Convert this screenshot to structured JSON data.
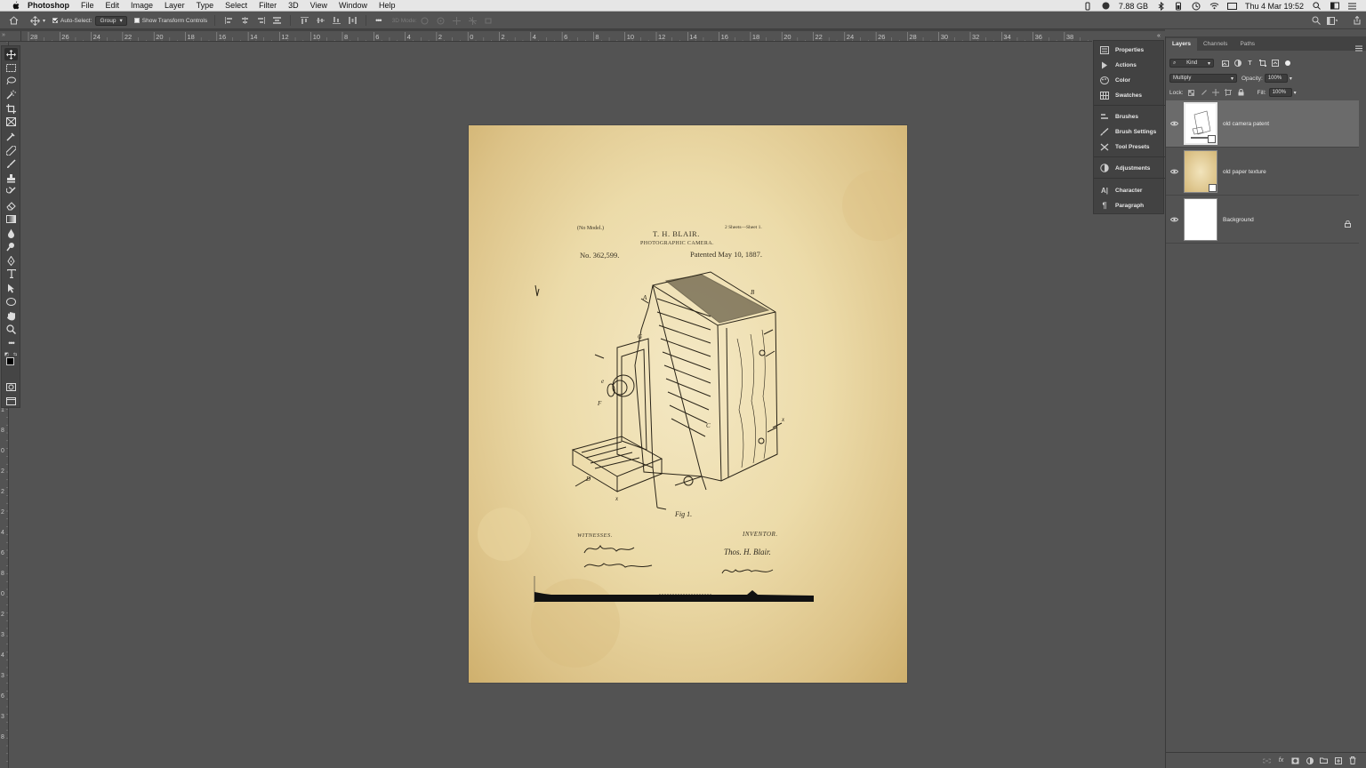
{
  "menubar": {
    "app_name": "Photoshop",
    "menus": [
      "File",
      "Edit",
      "Image",
      "Layer",
      "Type",
      "Select",
      "Filter",
      "3D",
      "View",
      "Window",
      "Help"
    ],
    "memory": "7.88 GB",
    "datetime": "Thu 4 Mar  19:52"
  },
  "options": {
    "auto_select_label": "Auto-Select:",
    "auto_select_checked": true,
    "auto_select_target": "Group",
    "transform_controls_label": "Show Transform Controls",
    "transform_controls_checked": false,
    "mode_3d_label": "3D Mode:"
  },
  "rulers": {
    "horizontal": [
      "28",
      "26",
      "24",
      "22",
      "20",
      "18",
      "16",
      "14",
      "12",
      "10",
      "8",
      "6",
      "4",
      "2",
      "0",
      "2",
      "4",
      "6",
      "8",
      "10",
      "12",
      "14",
      "16",
      "18",
      "20",
      "22",
      "24",
      "26",
      "28",
      "30",
      "32",
      "34",
      "36",
      "38"
    ],
    "vertical": [
      "1",
      "8",
      "0",
      "2",
      "2",
      "2",
      "4",
      "6",
      "8",
      "0",
      "2",
      "3",
      "4",
      "3",
      "6",
      "3",
      "8"
    ]
  },
  "tools": [
    "move-tool",
    "marquee-tool",
    "lasso-tool",
    "magic-wand-tool",
    "crop-tool",
    "frame-tool",
    "eyedropper-tool",
    "healing-brush-tool",
    "brush-tool",
    "clone-stamp-tool",
    "history-brush-tool",
    "eraser-tool",
    "gradient-tool",
    "blur-tool",
    "dodge-tool",
    "pen-tool",
    "type-tool",
    "path-selection-tool",
    "shape-tool",
    "hand-tool",
    "zoom-tool",
    "more-tools"
  ],
  "docked_panels": {
    "group1": [
      "Properties",
      "Actions",
      "Color",
      "Swatches"
    ],
    "group2": [
      "Brushes",
      "Brush Settings",
      "Tool Presets"
    ],
    "group3": [
      "Adjustments"
    ],
    "group4": [
      "Character",
      "Paragraph"
    ]
  },
  "layers_panel": {
    "tabs": [
      "Layers",
      "Channels",
      "Paths"
    ],
    "filter_kind": "Kind",
    "blend_mode": "Multiply",
    "opacity_label": "Opacity:",
    "opacity_value": "100%",
    "lock_label": "Lock:",
    "fill_label": "Fill:",
    "fill_value": "100%",
    "layers": [
      {
        "name": "old camera patent",
        "selected": true,
        "smart_object": true
      },
      {
        "name": "old paper texture",
        "selected": false,
        "smart_object": true
      },
      {
        "name": "Background",
        "selected": false,
        "locked": true
      }
    ]
  },
  "document": {
    "header_left": "(No Model.)",
    "header_name": "T. H. BLAIR.",
    "header_right": "2 Sheets—Sheet 1.",
    "header_title": "PHOTOGRAPHIC CAMERA.",
    "patent_no": "No. 362,599.",
    "patent_date": "Patented May 10, 1887.",
    "witnesses_label": "WITNESSES.",
    "inventor_label": "INVENTOR.",
    "inventor_sig": "Thos. H. Blair.",
    "figure_label": "Fig 1."
  },
  "colors": {
    "app_bg": "#535353",
    "panel_bg": "#424242",
    "paper": "#ecdba9"
  }
}
